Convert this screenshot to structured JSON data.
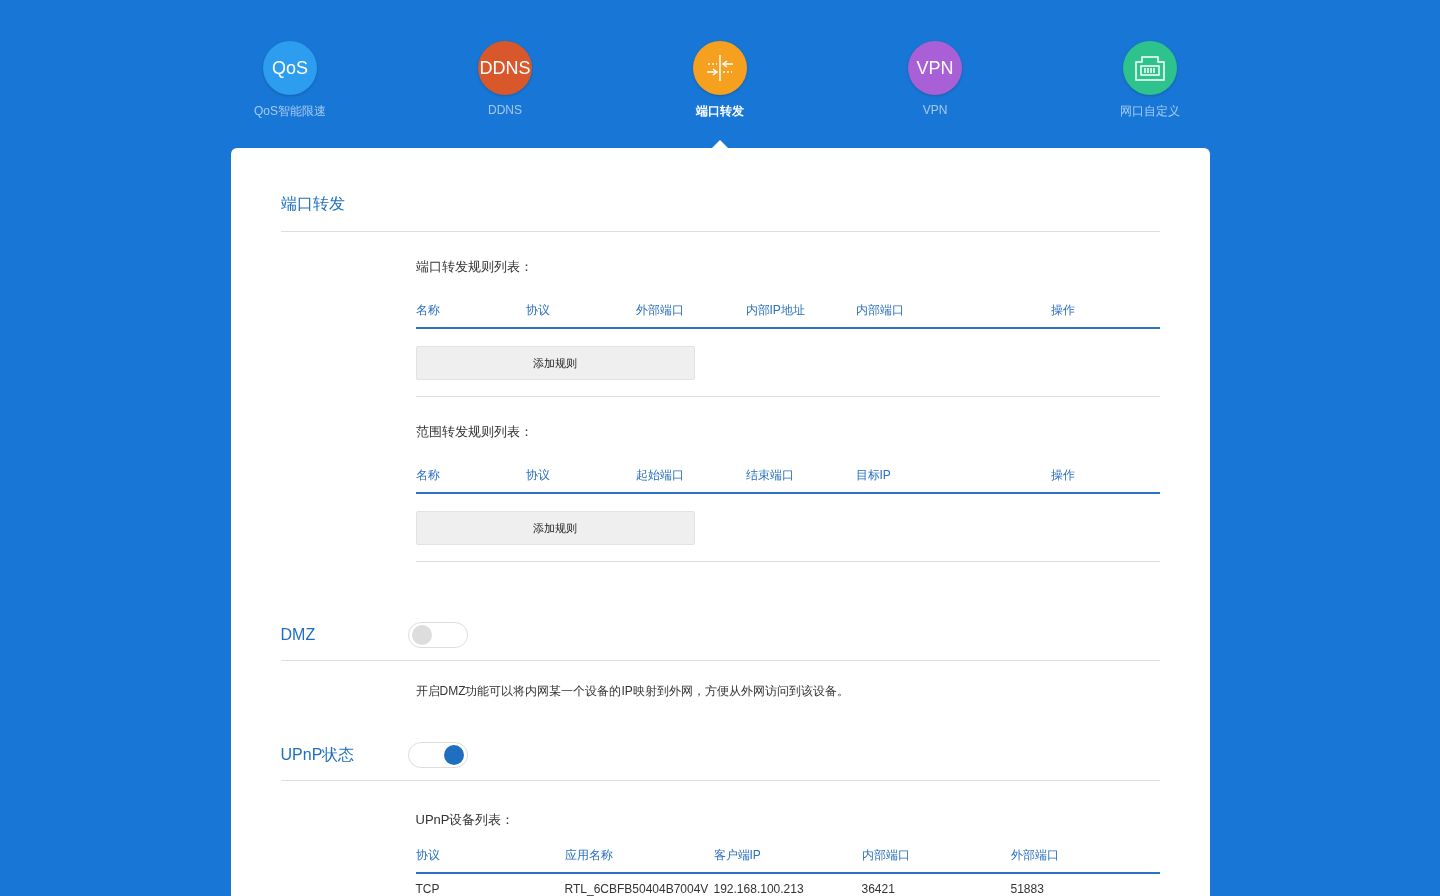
{
  "nav": [
    {
      "label": "QoS智能限速",
      "icon_text": "QoS",
      "color": "#2d9df0",
      "selected": false
    },
    {
      "label": "DDNS",
      "icon_text": "DDNS",
      "color": "#d9582b",
      "selected": false
    },
    {
      "label": "端口转发",
      "kind": "port",
      "color": "#f5a01e",
      "selected": true
    },
    {
      "label": "VPN",
      "icon_text": "VPN",
      "color": "#a95fd6",
      "selected": false
    },
    {
      "label": "网口自定义",
      "kind": "lan",
      "color": "#2ec28c",
      "selected": false
    }
  ],
  "section_title": "端口转发",
  "rule_tables": [
    {
      "title": "端口转发规则列表：",
      "columns": [
        "名称",
        "协议",
        "外部端口",
        "内部IP地址",
        "内部端口",
        "操作"
      ],
      "button": "添加规则"
    },
    {
      "title": "范围转发规则列表：",
      "columns": [
        "名称",
        "协议",
        "起始端口",
        "结束端口",
        "目标IP",
        "操作"
      ],
      "button": "添加规则"
    }
  ],
  "dmz": {
    "label": "DMZ",
    "on": false,
    "description": "开启DMZ功能可以将内网某一个设备的IP映射到外网，方便从外网访问到该设备。"
  },
  "upnp": {
    "label": "UPnP状态",
    "on": true,
    "list_title": "UPnP设备列表：",
    "columns": [
      "协议",
      "应用名称",
      "客户端IP",
      "内部端口",
      "外部端口"
    ],
    "rows": [
      [
        "TCP",
        "RTL_6CBFB50404B7004V",
        "192.168.100.213",
        "36421",
        "51883"
      ]
    ]
  }
}
